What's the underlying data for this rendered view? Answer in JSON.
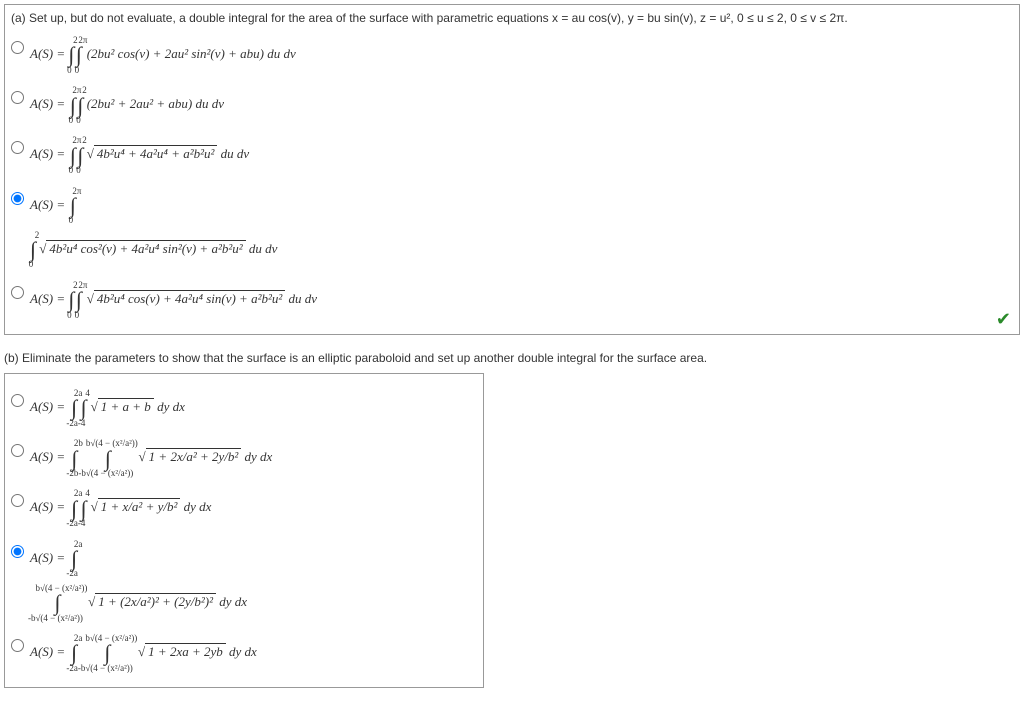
{
  "partA": {
    "question": "(a) Set up, but do not evaluate, a double integral for the area of the surface with parametric equations  x = au cos(v),  y = bu sin(v),  z = u²,  0 ≤ u ≤ 2,  0 ≤ v ≤ 2π.",
    "options": [
      {
        "selected": false,
        "label": "A(S) = ",
        "integral_outer_lower": "0",
        "integral_outer_upper": "2",
        "integral_inner_lower": "0",
        "integral_inner_upper": "2π",
        "integrand": "(2bu² cos(v) + 2au² sin²(v) + abu) du dv"
      },
      {
        "selected": false,
        "label": "A(S) = ",
        "integral_outer_lower": "0",
        "integral_outer_upper": "2π",
        "integral_inner_lower": "0",
        "integral_inner_upper": "2",
        "integrand": "(2bu² + 2au² + abu) du dv"
      },
      {
        "selected": false,
        "label": "A(S) = ",
        "integral_outer_lower": "0",
        "integral_outer_upper": "2π",
        "integral_inner_lower": "0",
        "integral_inner_upper": "2",
        "integrand_sqrt": "4b²u⁴ + 4a²u⁴ + a²b²u²",
        "tail": " du dv"
      },
      {
        "selected": true,
        "label": "A(S) = ",
        "integral_outer_lower": "0",
        "integral_outer_upper": "2π",
        "line2_lower": "0",
        "line2_upper": "2",
        "integrand_sqrt": "4b²u⁴ cos²(v) + 4a²u⁴ sin²(v) + a²b²u²",
        "tail": " du dv"
      },
      {
        "selected": false,
        "label": "A(S) = ",
        "integral_outer_lower": "0",
        "integral_outer_upper": "2",
        "integral_inner_lower": "0",
        "integral_inner_upper": "2π",
        "integrand_sqrt": "4b²u⁴ cos(v) + 4a²u⁴ sin(v) + a²b²u²",
        "tail": " du dv"
      }
    ]
  },
  "partB": {
    "question": "(b) Eliminate the parameters to show that the surface is an elliptic paraboloid and set up another double integral for the surface area.",
    "options": [
      {
        "selected": false,
        "label": "A(S) = ",
        "outer_lower": "-2a",
        "outer_upper": "2a",
        "inner_lower": "-4",
        "inner_upper": "4",
        "integrand_sqrt": "1 + a + b",
        "tail": " dy dx"
      },
      {
        "selected": false,
        "label": "A(S) = ",
        "outer_lower": "-2b",
        "outer_upper": "2b",
        "inner_lower_sqrt": "-b√(4 − (x²/a²))",
        "inner_upper_sqrt": "b√(4 − (x²/a²))",
        "integrand_sqrt": "1 + 2x/a² + 2y/b²",
        "tail": " dy dx"
      },
      {
        "selected": false,
        "label": "A(S) = ",
        "outer_lower": "-2a",
        "outer_upper": "2a",
        "inner_lower": "-4",
        "inner_upper": "4",
        "integrand_sqrt": "1 + x/a² + y/b²",
        "tail": " dy dx"
      },
      {
        "selected": true,
        "label": "A(S) = ",
        "outer_lower": "-2a",
        "outer_upper": "2a",
        "inner_lower_sqrt": "-b√(4 − (x²/a²))",
        "inner_upper_sqrt": "b√(4 − (x²/a²))",
        "integrand_sqrt": "1 + (2x/a²)² + (2y/b²)²",
        "tail": " dy dx"
      },
      {
        "selected": false,
        "label": "A(S) = ",
        "outer_lower": "-2a",
        "outer_upper": "2a",
        "inner_lower_sqrt": "-b√(4 − (x²/a²))",
        "inner_upper_sqrt": "b√(4 − (x²/a²))",
        "integrand_sqrt": "1 + 2xa + 2yb",
        "tail": " dy dx"
      }
    ]
  }
}
